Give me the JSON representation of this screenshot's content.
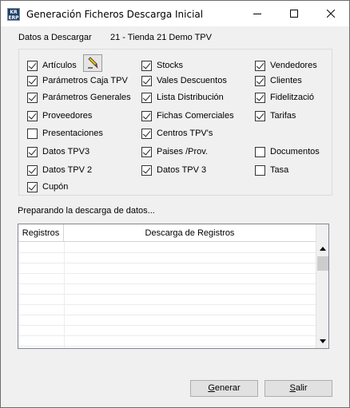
{
  "window": {
    "title": "Generación Ficheros Descarga Inicial",
    "icon_text": [
      "KR",
      "ERP"
    ]
  },
  "header": {
    "datos_label": "Datos a Descargar",
    "tienda_label": "21 - Tienda 21 Demo TPV"
  },
  "checkboxes": {
    "col1": [
      {
        "label": "Artículos",
        "checked": true
      },
      {
        "label": "Parámetros Caja TPV",
        "checked": true
      },
      {
        "label": "Parámetros Generales",
        "checked": true
      },
      {
        "label": "Proveedores",
        "checked": true
      },
      {
        "label": "Presentaciones",
        "checked": false
      },
      {
        "label": "Datos TPV3",
        "checked": true
      },
      {
        "label": "Datos TPV 2",
        "checked": true
      },
      {
        "label": "Cupón",
        "checked": true
      }
    ],
    "col2": [
      {
        "label": "Stocks",
        "checked": true
      },
      {
        "label": "Vales Descuentos",
        "checked": true
      },
      {
        "label": "Lista Distribución",
        "checked": true
      },
      {
        "label": "Fichas Comerciales",
        "checked": true
      },
      {
        "label": "Centros TPV's",
        "checked": true
      },
      {
        "label": "Paises /Prov.",
        "checked": true
      },
      {
        "label": "Datos TPV 3",
        "checked": true
      }
    ],
    "col3": [
      {
        "label": "Vendedores",
        "checked": true
      },
      {
        "label": "Clientes",
        "checked": true
      },
      {
        "label": "Fidelització",
        "checked": true
      },
      {
        "label": "Tarifas",
        "checked": true
      },
      {
        "label": "Documentos",
        "checked": false
      },
      {
        "label": "Tasa",
        "checked": false
      }
    ]
  },
  "status": "Preparando la descarga de datos...",
  "grid": {
    "columns": [
      "Registros",
      "Descarga de Registros"
    ]
  },
  "buttons": {
    "generar_mnemonic": "G",
    "generar_rest": "enerar",
    "salir_mnemonic": "S",
    "salir_rest": "alir"
  }
}
